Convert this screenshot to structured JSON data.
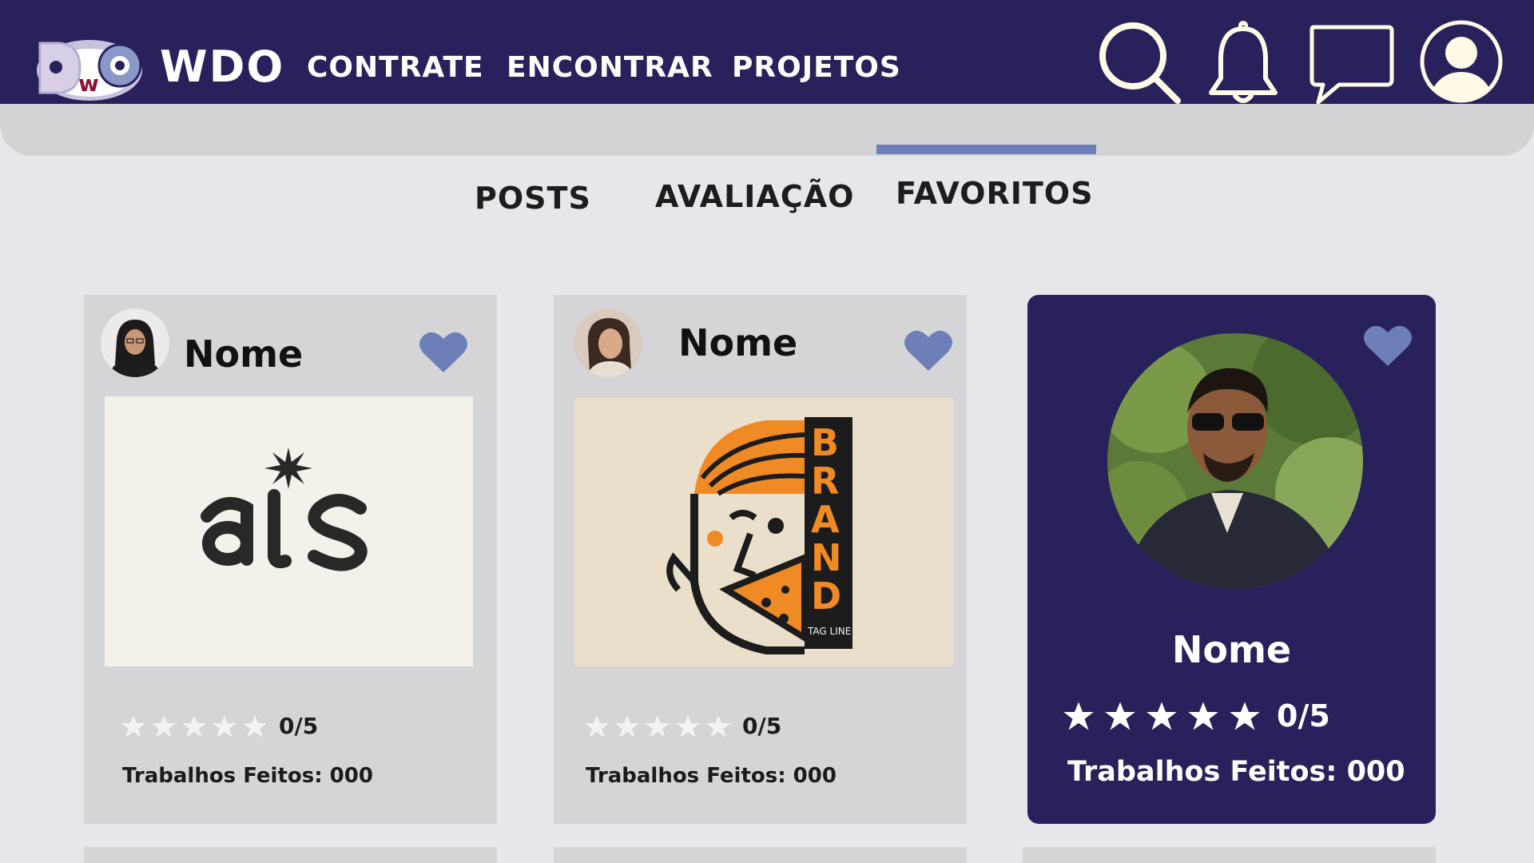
{
  "header": {
    "brand": "WDO",
    "nav": [
      "CONTRATE",
      "ENCONTRAR",
      "PROJETOS"
    ],
    "icons": [
      "search-icon",
      "bell-icon",
      "chat-icon",
      "profile-icon"
    ]
  },
  "tabs": {
    "items": [
      "POSTS",
      "AVALIAÇÃO",
      "FAVORITOS"
    ],
    "active": "FAVORITOS"
  },
  "cards": [
    {
      "name": "Nome",
      "rating": "0/5",
      "jobs": "Trabalhos Feitos: 000",
      "favorited": true,
      "image": "as-logo"
    },
    {
      "name": "Nome",
      "rating": "0/5",
      "jobs": "Trabalhos Feitos: 000",
      "favorited": true,
      "image": "brand-pizza-logo"
    },
    {
      "name": "Nome",
      "rating": "0/5",
      "jobs": "Trabalhos Feitos: 000",
      "favorited": true,
      "image": "profile-photo"
    }
  ],
  "colors": {
    "header_bg": "#29215c",
    "accent": "#6d7fb8",
    "page_bg": "#e6e7eb",
    "card_bg": "#d5d5d7",
    "icon_stroke": "#fffbe6"
  }
}
